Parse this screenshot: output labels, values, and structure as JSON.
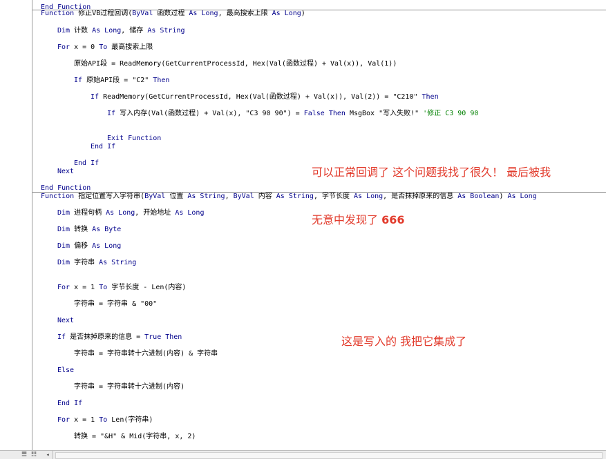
{
  "code_lines": [
    {
      "segs": [
        {
          "t": "End Function",
          "c": "kw"
        }
      ]
    },
    {
      "segs": [
        {
          "t": "Function ",
          "c": "kw"
        },
        {
          "t": "修正VB过程回调(",
          "c": ""
        },
        {
          "t": "ByVal",
          "c": "kw"
        },
        {
          "t": " 函数过程 ",
          "c": ""
        },
        {
          "t": "As Long",
          "c": "kw"
        },
        {
          "t": ", 最高搜索上限 ",
          "c": ""
        },
        {
          "t": "As Long",
          "c": "kw"
        },
        {
          "t": ")",
          "c": ""
        }
      ]
    },
    {
      "segs": [
        {
          "t": "Dim",
          "c": "kw"
        },
        {
          "t": " 计数 ",
          "c": ""
        },
        {
          "t": "As Long",
          "c": "kw"
        },
        {
          "t": ", 储存 ",
          "c": ""
        },
        {
          "t": "As String",
          "c": "kw"
        }
      ]
    },
    {
      "segs": [
        {
          "t": "For",
          "c": "kw"
        },
        {
          "t": " x = 0 ",
          "c": ""
        },
        {
          "t": "To",
          "c": "kw"
        },
        {
          "t": " 最高搜索上限",
          "c": ""
        }
      ]
    },
    {
      "segs": [
        {
          "t": "原始API段 = ReadMemory(GetCurrentProcessId, Hex(Val(函数过程) + Val(x)), Val(1))",
          "c": ""
        }
      ]
    },
    {
      "segs": [
        {
          "t": "If",
          "c": "kw"
        },
        {
          "t": " 原始API段 = \"C2\" ",
          "c": ""
        },
        {
          "t": "Then",
          "c": "kw"
        }
      ]
    },
    {
      "segs": [
        {
          "t": "If",
          "c": "kw"
        },
        {
          "t": " ReadMemory(GetCurrentProcessId, Hex(Val(函数过程) + Val(x)), Val(2)) = \"C210\" ",
          "c": ""
        },
        {
          "t": "Then",
          "c": "kw"
        }
      ]
    },
    {
      "segs": [
        {
          "t": "If",
          "c": "kw"
        },
        {
          "t": " 写入内存(Val(函数过程) + Val(x), \"C3 90 90\") = ",
          "c": ""
        },
        {
          "t": "False Then",
          "c": "kw"
        },
        {
          "t": " MsgBox \"写入失败!\" ",
          "c": ""
        },
        {
          "t": "'修正 C3 90 90",
          "c": "cm"
        }
      ]
    },
    {
      "segs": [
        {
          "t": "Exit Function",
          "c": "kw"
        }
      ]
    },
    {
      "segs": [
        {
          "t": "End If",
          "c": "kw"
        }
      ]
    },
    {
      "segs": [
        {
          "t": "End If",
          "c": "kw"
        }
      ]
    },
    {
      "segs": [
        {
          "t": "Next",
          "c": "kw"
        }
      ]
    },
    {
      "segs": [
        {
          "t": "End Function",
          "c": "kw"
        }
      ]
    },
    {
      "segs": [
        {
          "t": "Function ",
          "c": "kw"
        },
        {
          "t": "指定位置写入字符串(",
          "c": ""
        },
        {
          "t": "ByVal",
          "c": "kw"
        },
        {
          "t": " 位置 ",
          "c": ""
        },
        {
          "t": "As String",
          "c": "kw"
        },
        {
          "t": ", ",
          "c": ""
        },
        {
          "t": "ByVal",
          "c": "kw"
        },
        {
          "t": " 内容 ",
          "c": ""
        },
        {
          "t": "As String",
          "c": "kw"
        },
        {
          "t": ", 字节长度 ",
          "c": ""
        },
        {
          "t": "As Long",
          "c": "kw"
        },
        {
          "t": ", 是否抹掉原来的信息 ",
          "c": ""
        },
        {
          "t": "As Boolean",
          "c": "kw"
        },
        {
          "t": ") ",
          "c": ""
        },
        {
          "t": "As Long",
          "c": "kw"
        }
      ]
    },
    {
      "segs": [
        {
          "t": "Dim",
          "c": "kw"
        },
        {
          "t": " 进程句柄 ",
          "c": ""
        },
        {
          "t": "As Long",
          "c": "kw"
        },
        {
          "t": ", 开始地址 ",
          "c": ""
        },
        {
          "t": "As Long",
          "c": "kw"
        }
      ]
    },
    {
      "segs": [
        {
          "t": "Dim",
          "c": "kw"
        },
        {
          "t": " 转换 ",
          "c": ""
        },
        {
          "t": "As Byte",
          "c": "kw"
        }
      ]
    },
    {
      "segs": [
        {
          "t": "Dim",
          "c": "kw"
        },
        {
          "t": " 偏移 ",
          "c": ""
        },
        {
          "t": "As Long",
          "c": "kw"
        }
      ]
    },
    {
      "segs": [
        {
          "t": "Dim",
          "c": "kw"
        },
        {
          "t": " 字符串 ",
          "c": ""
        },
        {
          "t": "As String",
          "c": "kw"
        }
      ]
    },
    {
      "segs": [
        {
          "t": "For",
          "c": "kw"
        },
        {
          "t": " x = 1 ",
          "c": ""
        },
        {
          "t": "To",
          "c": "kw"
        },
        {
          "t": " 字节长度 - Len(内容)",
          "c": ""
        }
      ]
    },
    {
      "segs": [
        {
          "t": "字符串 = 字符串 & \"00\"",
          "c": ""
        }
      ]
    },
    {
      "segs": [
        {
          "t": "Next",
          "c": "kw"
        }
      ]
    },
    {
      "segs": [
        {
          "t": "If",
          "c": "kw"
        },
        {
          "t": " 是否抹掉原来的信息 = ",
          "c": ""
        },
        {
          "t": "True Then",
          "c": "kw"
        }
      ]
    },
    {
      "segs": [
        {
          "t": "字符串 = 字符串转十六进制(内容) & 字符串",
          "c": ""
        }
      ]
    },
    {
      "segs": [
        {
          "t": "Else",
          "c": "kw"
        }
      ]
    },
    {
      "segs": [
        {
          "t": "字符串 = 字符串转十六进制(内容)",
          "c": ""
        }
      ]
    },
    {
      "segs": [
        {
          "t": "End If",
          "c": "kw"
        }
      ]
    },
    {
      "segs": [
        {
          "t": "For",
          "c": "kw"
        },
        {
          "t": " x = 1 ",
          "c": ""
        },
        {
          "t": "To",
          "c": "kw"
        },
        {
          "t": " Len(字符串)",
          "c": ""
        }
      ]
    },
    {
      "segs": [
        {
          "t": "转换 = \"&H\" & Mid(字符串, x, 2)",
          "c": ""
        }
      ]
    }
  ],
  "annotations": {
    "note1_line1": "可以正常回调了 这个问题我找了很久！ 最后被我",
    "note1_line2_prefix": "无意中发现了 ",
    "note1_line2_bold": "666",
    "note2": "这是写入的 我把它集成了"
  },
  "statusbar": {
    "procedure_view_icon": "procedure-view-icon",
    "full_module_view_icon": "full-module-view-icon",
    "scroll_left_glyph": "◂"
  }
}
